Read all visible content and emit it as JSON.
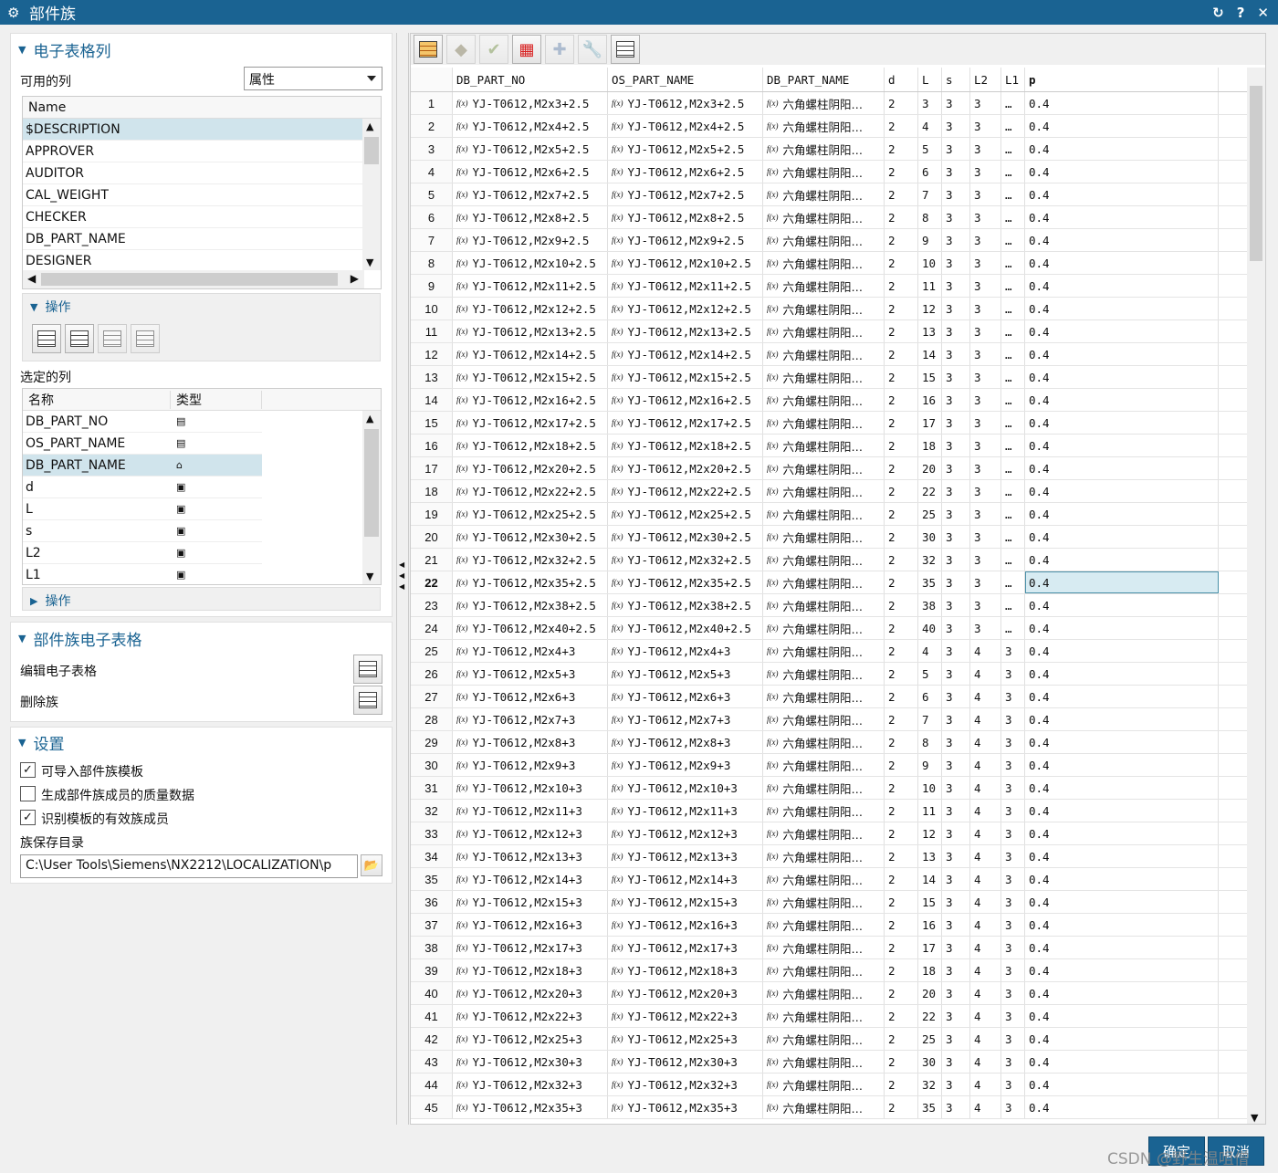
{
  "window": {
    "title": "部件族"
  },
  "spreadsheet_columns": {
    "title": "电子表格列",
    "available_label": "可用的列",
    "filter_value": "属性",
    "list_header": "Name",
    "items": [
      "$DESCRIPTION",
      "APPROVER",
      "AUDITOR",
      "CAL_WEIGHT",
      "CHECKER",
      "DB_PART_NAME",
      "DESIGNER"
    ],
    "operations_label": "操作",
    "selected_label": "选定的列",
    "selected_headers": [
      "名称",
      "类型"
    ],
    "selected_items": [
      "DB_PART_NO",
      "OS_PART_NAME",
      "DB_PART_NAME",
      "d",
      "L",
      "s",
      "L2",
      "L1"
    ],
    "operations2_label": "操作"
  },
  "family_spreadsheet": {
    "title": "部件族电子表格",
    "edit_label": "编辑电子表格",
    "delete_label": "删除族"
  },
  "settings": {
    "title": "设置",
    "opt1": "可导入部件族模板",
    "opt1_checked": true,
    "opt2": "生成部件族成员的质量数据",
    "opt2_checked": false,
    "opt3": "识别模板的有效族成员",
    "opt3_checked": true,
    "dir_label": "族保存目录",
    "dir_value": "C:\\User Tools\\Siemens\\NX2212\\LOCALIZATION\\p"
  },
  "table": {
    "headers": [
      "DB_PART_NO",
      "OS_PART_NAME",
      "DB_PART_NAME",
      "d",
      "L",
      "s",
      "L2",
      "L1",
      "p"
    ],
    "fx_label": "f(x)",
    "name_text": "六角螺柱阴阳…",
    "selected_row": 22,
    "rows": [
      [
        "1",
        "YJ-T0612,M2x3+2.5",
        "2",
        "3",
        "3",
        "3",
        "…",
        "0.4"
      ],
      [
        "2",
        "YJ-T0612,M2x4+2.5",
        "2",
        "4",
        "3",
        "3",
        "…",
        "0.4"
      ],
      [
        "3",
        "YJ-T0612,M2x5+2.5",
        "2",
        "5",
        "3",
        "3",
        "…",
        "0.4"
      ],
      [
        "4",
        "YJ-T0612,M2x6+2.5",
        "2",
        "6",
        "3",
        "3",
        "…",
        "0.4"
      ],
      [
        "5",
        "YJ-T0612,M2x7+2.5",
        "2",
        "7",
        "3",
        "3",
        "…",
        "0.4"
      ],
      [
        "6",
        "YJ-T0612,M2x8+2.5",
        "2",
        "8",
        "3",
        "3",
        "…",
        "0.4"
      ],
      [
        "7",
        "YJ-T0612,M2x9+2.5",
        "2",
        "9",
        "3",
        "3",
        "…",
        "0.4"
      ],
      [
        "8",
        "YJ-T0612,M2x10+2.5",
        "2",
        "10",
        "3",
        "3",
        "…",
        "0.4"
      ],
      [
        "9",
        "YJ-T0612,M2x11+2.5",
        "2",
        "11",
        "3",
        "3",
        "…",
        "0.4"
      ],
      [
        "10",
        "YJ-T0612,M2x12+2.5",
        "2",
        "12",
        "3",
        "3",
        "…",
        "0.4"
      ],
      [
        "11",
        "YJ-T0612,M2x13+2.5",
        "2",
        "13",
        "3",
        "3",
        "…",
        "0.4"
      ],
      [
        "12",
        "YJ-T0612,M2x14+2.5",
        "2",
        "14",
        "3",
        "3",
        "…",
        "0.4"
      ],
      [
        "13",
        "YJ-T0612,M2x15+2.5",
        "2",
        "15",
        "3",
        "3",
        "…",
        "0.4"
      ],
      [
        "14",
        "YJ-T0612,M2x16+2.5",
        "2",
        "16",
        "3",
        "3",
        "…",
        "0.4"
      ],
      [
        "15",
        "YJ-T0612,M2x17+2.5",
        "2",
        "17",
        "3",
        "3",
        "…",
        "0.4"
      ],
      [
        "16",
        "YJ-T0612,M2x18+2.5",
        "2",
        "18",
        "3",
        "3",
        "…",
        "0.4"
      ],
      [
        "17",
        "YJ-T0612,M2x20+2.5",
        "2",
        "20",
        "3",
        "3",
        "…",
        "0.4"
      ],
      [
        "18",
        "YJ-T0612,M2x22+2.5",
        "2",
        "22",
        "3",
        "3",
        "…",
        "0.4"
      ],
      [
        "19",
        "YJ-T0612,M2x25+2.5",
        "2",
        "25",
        "3",
        "3",
        "…",
        "0.4"
      ],
      [
        "20",
        "YJ-T0612,M2x30+2.5",
        "2",
        "30",
        "3",
        "3",
        "…",
        "0.4"
      ],
      [
        "21",
        "YJ-T0612,M2x32+2.5",
        "2",
        "32",
        "3",
        "3",
        "…",
        "0.4"
      ],
      [
        "22",
        "YJ-T0612,M2x35+2.5",
        "2",
        "35",
        "3",
        "3",
        "…",
        "0.4"
      ],
      [
        "23",
        "YJ-T0612,M2x38+2.5",
        "2",
        "38",
        "3",
        "3",
        "…",
        "0.4"
      ],
      [
        "24",
        "YJ-T0612,M2x40+2.5",
        "2",
        "40",
        "3",
        "3",
        "…",
        "0.4"
      ],
      [
        "25",
        "YJ-T0612,M2x4+3",
        "2",
        "4",
        "3",
        "4",
        "3",
        "0.4"
      ],
      [
        "26",
        "YJ-T0612,M2x5+3",
        "2",
        "5",
        "3",
        "4",
        "3",
        "0.4"
      ],
      [
        "27",
        "YJ-T0612,M2x6+3",
        "2",
        "6",
        "3",
        "4",
        "3",
        "0.4"
      ],
      [
        "28",
        "YJ-T0612,M2x7+3",
        "2",
        "7",
        "3",
        "4",
        "3",
        "0.4"
      ],
      [
        "29",
        "YJ-T0612,M2x8+3",
        "2",
        "8",
        "3",
        "4",
        "3",
        "0.4"
      ],
      [
        "30",
        "YJ-T0612,M2x9+3",
        "2",
        "9",
        "3",
        "4",
        "3",
        "0.4"
      ],
      [
        "31",
        "YJ-T0612,M2x10+3",
        "2",
        "10",
        "3",
        "4",
        "3",
        "0.4"
      ],
      [
        "32",
        "YJ-T0612,M2x11+3",
        "2",
        "11",
        "3",
        "4",
        "3",
        "0.4"
      ],
      [
        "33",
        "YJ-T0612,M2x12+3",
        "2",
        "12",
        "3",
        "4",
        "3",
        "0.4"
      ],
      [
        "34",
        "YJ-T0612,M2x13+3",
        "2",
        "13",
        "3",
        "4",
        "3",
        "0.4"
      ],
      [
        "35",
        "YJ-T0612,M2x14+3",
        "2",
        "14",
        "3",
        "4",
        "3",
        "0.4"
      ],
      [
        "36",
        "YJ-T0612,M2x15+3",
        "2",
        "15",
        "3",
        "4",
        "3",
        "0.4"
      ],
      [
        "37",
        "YJ-T0612,M2x16+3",
        "2",
        "16",
        "3",
        "4",
        "3",
        "0.4"
      ],
      [
        "38",
        "YJ-T0612,M2x17+3",
        "2",
        "17",
        "3",
        "4",
        "3",
        "0.4"
      ],
      [
        "39",
        "YJ-T0612,M2x18+3",
        "2",
        "18",
        "3",
        "4",
        "3",
        "0.4"
      ],
      [
        "40",
        "YJ-T0612,M2x20+3",
        "2",
        "20",
        "3",
        "4",
        "3",
        "0.4"
      ],
      [
        "41",
        "YJ-T0612,M2x22+3",
        "2",
        "22",
        "3",
        "4",
        "3",
        "0.4"
      ],
      [
        "42",
        "YJ-T0612,M2x25+3",
        "2",
        "25",
        "3",
        "4",
        "3",
        "0.4"
      ],
      [
        "43",
        "YJ-T0612,M2x30+3",
        "2",
        "30",
        "3",
        "4",
        "3",
        "0.4"
      ],
      [
        "44",
        "YJ-T0612,M2x32+3",
        "2",
        "32",
        "3",
        "4",
        "3",
        "0.4"
      ],
      [
        "45",
        "YJ-T0612,M2x35+3",
        "2",
        "35",
        "3",
        "4",
        "3",
        "0.4"
      ]
    ]
  },
  "buttons": {
    "ok": "确定",
    "cancel": "取消"
  },
  "watermark": "CSDN @野生温咀僧",
  "colors": {
    "accent": "#1a6392",
    "selection": "#d0e4ec"
  }
}
